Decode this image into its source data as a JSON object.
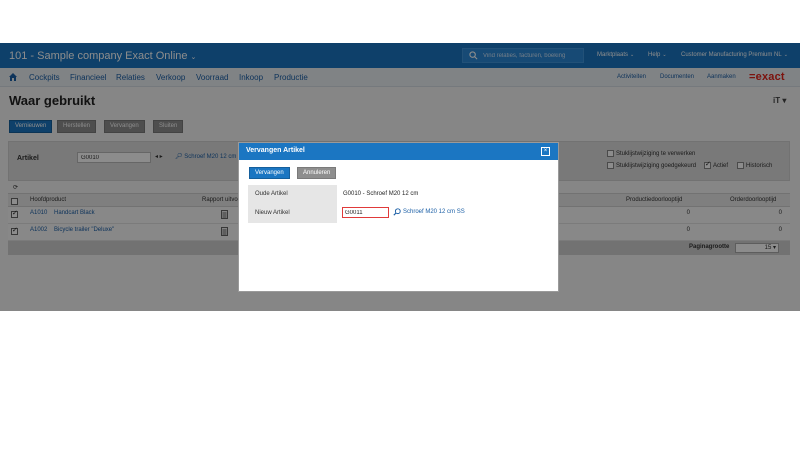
{
  "topbar": {
    "title": "101 - Sample company Exact Online",
    "search_placeholder": "Vind relaties, facturen, boeking",
    "links": [
      "Marktplaats",
      "Help",
      "Customer Manufacturing Premium NL"
    ]
  },
  "nav": {
    "items": [
      "Cockpits",
      "Financieel",
      "Relaties",
      "Verkoop",
      "Voorraad",
      "Inkoop",
      "Productie"
    ],
    "right_links": [
      "Activiteiten",
      "Documenten",
      "Aanmaken"
    ],
    "logo": "=exact"
  },
  "page": {
    "title": "Waar gebruikt",
    "user_menu": "iT"
  },
  "actions": [
    "Vernieuwen",
    "Herstellen",
    "Vervangen",
    "Sluiten"
  ],
  "filter": {
    "label": "Artikel",
    "value": "G0010",
    "link_text": "Schroef M20 12 cm",
    "checkboxes": [
      {
        "label": "Stuklijstwijziging te verwerken",
        "checked": false
      },
      {
        "label": "Stuklijstwijziging goedgekeurd",
        "checked": false
      },
      {
        "label": "Actief",
        "checked": true
      },
      {
        "label": "Historisch",
        "checked": false
      }
    ]
  },
  "table": {
    "columns": [
      "Hoofdproduct",
      "Rapport uitvoer",
      "Productiedoorlooptijd",
      "Orderdoorlooptijd"
    ],
    "rows": [
      {
        "code": "A1010",
        "name": "Handcart Black",
        "production_leadtime": "0",
        "order_leadtime": "0",
        "checked": true
      },
      {
        "code": "A1002",
        "name": "Bicycle trailer \"Deluxe\"",
        "production_leadtime": "0",
        "order_leadtime": "0",
        "checked": true
      }
    ],
    "page_size_label": "Paginagrootte",
    "page_size_value": "15"
  },
  "modal": {
    "title": "Vervangen Artikel",
    "close_glyph": "×",
    "buttons": {
      "replace": "Vervangen",
      "cancel": "Annuleren"
    },
    "old_label": "Oude Artikel",
    "old_value": "G0010 - Schroef M20 12 cm",
    "new_label": "Nieuw Artikel",
    "new_value": "G0011",
    "new_lookup": "Schroef M20 12 cm SS"
  },
  "colors": {
    "brand_blue": "#1b76c2",
    "logo_red": "#e2231a",
    "error_border": "#e03a3a"
  },
  "icons": [
    "search-icon",
    "home-icon",
    "refresh-icon",
    "document-icon",
    "magnifier-icon",
    "close-icon"
  ]
}
